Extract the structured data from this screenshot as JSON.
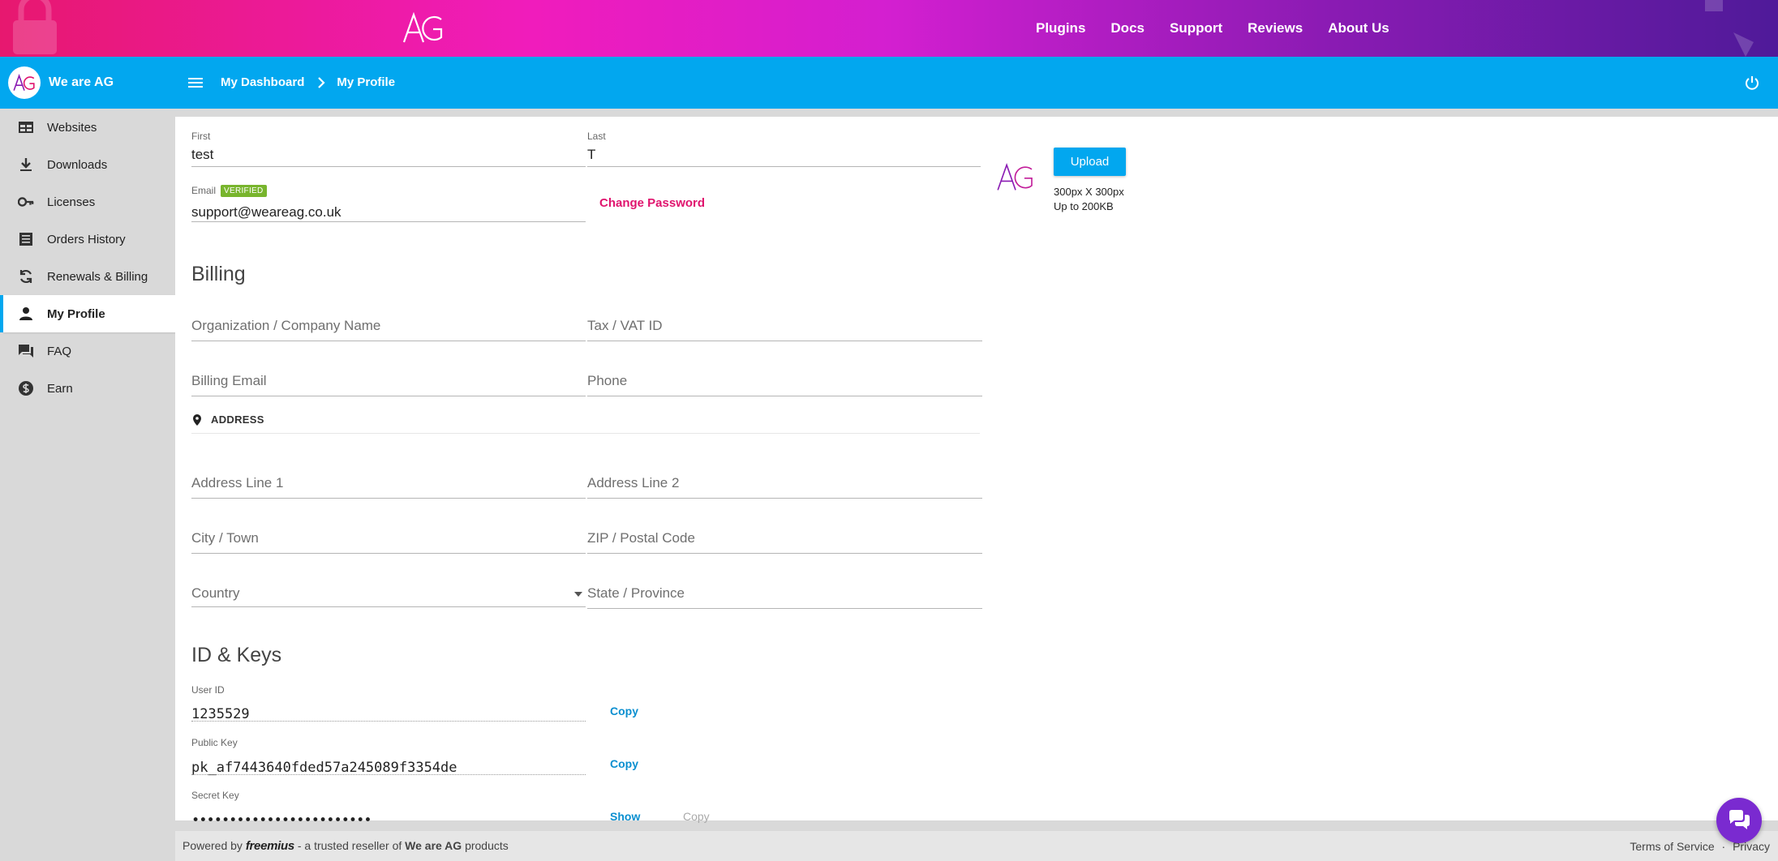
{
  "topnav": {
    "items": [
      "Plugins",
      "Docs",
      "Support",
      "Reviews",
      "About Us"
    ]
  },
  "appbar": {
    "app_name": "We are AG",
    "breadcrumb": [
      "My Dashboard",
      "My Profile"
    ]
  },
  "sidebar": {
    "items": [
      {
        "label": "Websites",
        "icon": "websites-icon"
      },
      {
        "label": "Downloads",
        "icon": "download-icon"
      },
      {
        "label": "Licenses",
        "icon": "key-icon"
      },
      {
        "label": "Orders History",
        "icon": "list-icon"
      },
      {
        "label": "Renewals & Billing",
        "icon": "renew-icon"
      },
      {
        "label": "My Profile",
        "icon": "user-icon",
        "active": true
      },
      {
        "label": "FAQ",
        "icon": "chat-icon"
      },
      {
        "label": "Earn",
        "icon": "dollar-icon"
      }
    ]
  },
  "profile": {
    "first_label": "First",
    "first_value": "test",
    "last_label": "Last",
    "last_value": "T",
    "email_label": "Email",
    "email_badge": "VERIFIED",
    "email_value": "support@weareag.co.uk",
    "change_password": "Change Password",
    "upload_label": "Upload",
    "upload_note_1": "300px X 300px",
    "upload_note_2": "Up to 200KB"
  },
  "billing": {
    "title": "Billing",
    "company_ph": "Organization / Company Name",
    "tax_ph": "Tax / VAT ID",
    "email_ph": "Billing Email",
    "phone_ph": "Phone",
    "address_head": "ADDRESS",
    "addr1_ph": "Address Line 1",
    "addr2_ph": "Address Line 2",
    "city_ph": "City / Town",
    "zip_ph": "ZIP / Postal Code",
    "country_ph": "Country",
    "state_ph": "State / Province"
  },
  "keys": {
    "title": "ID & Keys",
    "user_id_label": "User ID",
    "user_id_value": "1235529",
    "public_key_label": "Public Key",
    "public_key_value": "pk_af7443640fded57a245089f3354de",
    "secret_key_label": "Secret Key",
    "secret_key_value": "••••••••••••••••••••••••",
    "copy_label": "Copy",
    "show_label": "Show"
  },
  "footer": {
    "powered_by": "Powered by",
    "brand": "freemius",
    "reseller_text": "- a trusted reseller of",
    "company": "We are AG",
    "products": "products",
    "terms": "Terms of Service",
    "dot": "·",
    "privacy": "Privacy"
  },
  "colors": {
    "accent": "#02a7ef",
    "brand_pink": "#e0146e",
    "verified": "#78b52d",
    "chat": "#7a2ad0"
  }
}
